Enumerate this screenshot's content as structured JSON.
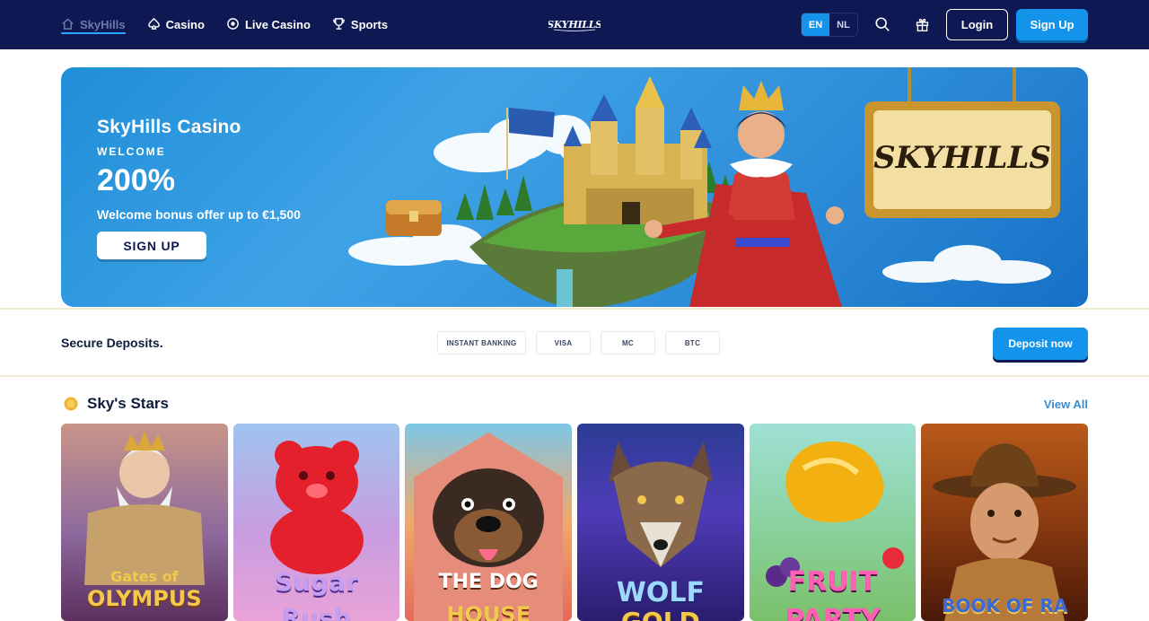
{
  "header": {
    "nav": [
      {
        "label": "SkyHills",
        "icon": "home-icon",
        "active": true
      },
      {
        "label": "Casino",
        "icon": "spade-icon"
      },
      {
        "label": "Live Casino",
        "icon": "chip-icon"
      },
      {
        "label": "Sports",
        "icon": "trophy-icon"
      }
    ],
    "brand_logo": "SKYHILLS",
    "languages": [
      "EN",
      "NL"
    ],
    "active_language": "EN",
    "login_label": "Login",
    "signup_label": "Sign Up"
  },
  "hero": {
    "title": "SkyHills Casino",
    "subtitle": "WELCOME",
    "percent": "200%",
    "offer": "Welcome bonus offer up to €1,500",
    "cta": "SIGN UP",
    "sign_text": "SKYHILLS"
  },
  "deposits": {
    "label": "Secure Deposits.",
    "methods": [
      "INSTANT BANKING",
      "VISA",
      "MC",
      "BTC"
    ],
    "cta": "Deposit now"
  },
  "stars": {
    "title": "Sky's Stars",
    "view_all": "View All",
    "games": [
      {
        "line1": "Gates of",
        "line2": "OLYMPUS"
      },
      {
        "line1": "Sugar",
        "line2": "Rush"
      },
      {
        "line1": "THE DOG",
        "line2": "HOUSE"
      },
      {
        "line1": "WOLF",
        "line2": "GOLD"
      },
      {
        "line1": "FRUIT",
        "line2": "PARTY"
      },
      {
        "line1": "BOOK OF RA",
        "line2": ""
      }
    ]
  },
  "colors": {
    "header_bg": "#0e1852",
    "accent": "#1393ea",
    "hero_blue": "#2f8fd9"
  }
}
